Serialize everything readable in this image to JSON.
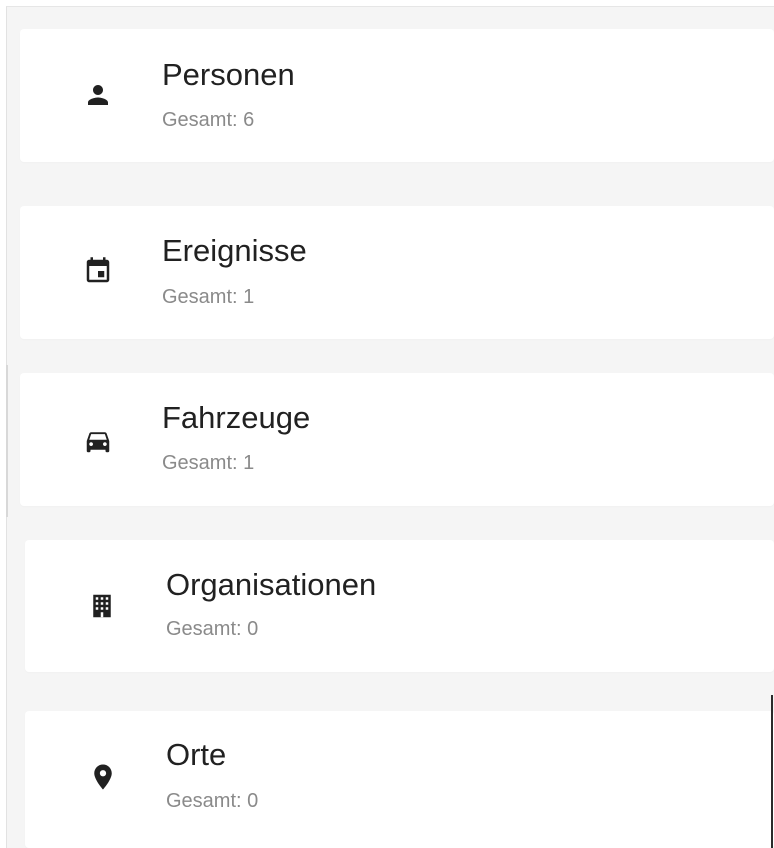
{
  "items": [
    {
      "label": "Personen",
      "count": "Gesamt: 6",
      "icon": "person-icon"
    },
    {
      "label": "Ereignisse",
      "count": "Gesamt: 1",
      "icon": "calendar-event-icon"
    },
    {
      "label": "Fahrzeuge",
      "count": "Gesamt: 1",
      "icon": "car-icon"
    },
    {
      "label": "Organisationen",
      "count": "Gesamt: 0",
      "icon": "building-icon"
    },
    {
      "label": "Orte",
      "count": "Gesamt: 0",
      "icon": "location-pin-icon"
    }
  ],
  "colors": {
    "background": "#f5f5f5",
    "card": "#ffffff",
    "title": "#212121",
    "subtitle": "#8a8a8a",
    "icon": "#212121"
  }
}
